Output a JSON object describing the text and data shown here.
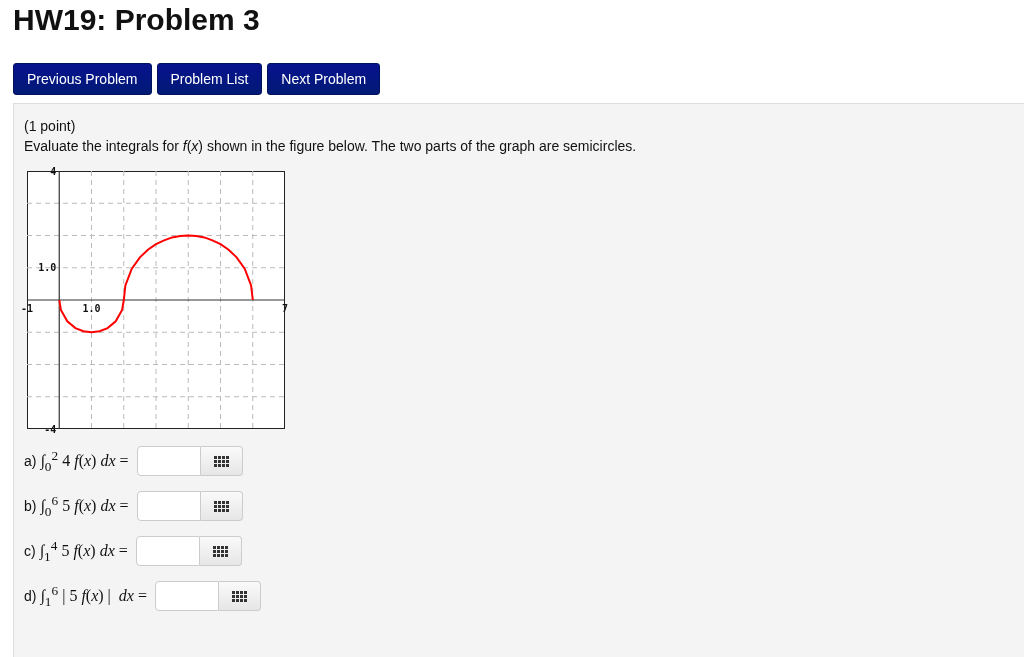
{
  "title": "HW19: Problem 3",
  "nav_buttons": [
    "Previous Problem",
    "Problem List",
    "Next Problem"
  ],
  "problem": {
    "points": "(1 point)",
    "statement": "Evaluate the integrals for *f*(*x*) shown in the figure below. The two parts of the graph are semicircles.",
    "chart_data": {
      "type": "line",
      "xlim": [
        -1,
        7
      ],
      "ylim": [
        -4,
        4
      ],
      "xticks": [
        {
          "value": -1,
          "label": "-1"
        },
        {
          "value": 1,
          "label": "1.0"
        },
        {
          "value": 7,
          "label": "7"
        }
      ],
      "yticks": [
        {
          "value": -4,
          "label": "-4"
        },
        {
          "value": 1,
          "label": "1.0"
        },
        {
          "value": 4,
          "label": "4"
        }
      ],
      "x": [
        0,
        0.05,
        0.25,
        0.5,
        0.75,
        1,
        1.25,
        1.5,
        1.75,
        1.95,
        2,
        2.05,
        2.25,
        2.5,
        2.75,
        3,
        3.25,
        3.5,
        3.75,
        4,
        4.25,
        4.5,
        4.75,
        5,
        5.25,
        5.5,
        5.75,
        5.95,
        6
      ],
      "series": [
        {
          "color": "#ff0000",
          "values": [
            0,
            -0.31,
            -0.66,
            -0.87,
            -0.97,
            -1,
            -0.97,
            -0.87,
            -0.66,
            -0.31,
            0,
            0.45,
            0.97,
            1.32,
            1.56,
            1.73,
            1.85,
            1.94,
            1.98,
            2,
            1.98,
            1.94,
            1.85,
            1.73,
            1.56,
            1.32,
            0.97,
            0.45,
            0
          ]
        }
      ]
    },
    "parts": [
      {
        "label": "a)",
        "formula": "∫$_{0}$$^{2}$ 4 *f*(*x*) *dx* ="
      },
      {
        "label": "b)",
        "formula": "∫$_{0}$$^{6}$ 5 *f*(*x*) *dx* ="
      },
      {
        "label": "c)",
        "formula": "∫$_{1}$$^{4}$ 5 *f*(*x*) *dx* ="
      },
      {
        "label": "d)",
        "formula": "∫$_{1}$$^{6}$ | 5 *f*(*x*) |  *dx* ="
      }
    ]
  }
}
